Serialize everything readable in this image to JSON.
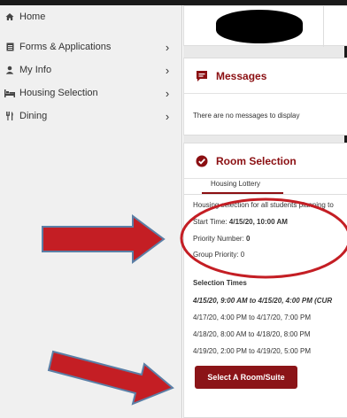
{
  "sidebar": {
    "items": [
      {
        "label": "Home",
        "icon": "home-icon",
        "chevron": false
      },
      {
        "label": "Forms & Applications",
        "icon": "document-icon",
        "chevron": true
      },
      {
        "label": "My Info",
        "icon": "user-icon",
        "chevron": true
      },
      {
        "label": "Housing Selection",
        "icon": "bed-icon",
        "chevron": true
      },
      {
        "label": "Dining",
        "icon": "utensils-icon",
        "chevron": true
      }
    ]
  },
  "messages": {
    "title": "Messages",
    "empty_text": "There are no messages to display"
  },
  "room_selection": {
    "title": "Room Selection",
    "tab_label": "Housing Lottery",
    "description": "Housing selection for all students planning to",
    "start_time_label": "Start Time:",
    "start_time_value": "4/15/20, 10:00 AM",
    "priority_label": "Priority Number:",
    "priority_value": "0",
    "group_priority": "Group Priority: 0",
    "selection_times_header": "Selection Times",
    "times": [
      "4/15/20, 9:00 AM to 4/15/20, 4:00 PM (CUR",
      "4/17/20, 4:00 PM to 4/17/20, 7:00 PM",
      "4/18/20, 8:00 AM to 4/18/20, 8:00 PM",
      "4/19/20, 2:00 PM to 4/19/20, 5:00 PM"
    ],
    "select_button": "Select A Room/Suite"
  },
  "colors": {
    "brand": "#8b0f12",
    "annotation_red": "#c41e24",
    "annotation_blue": "#5b7fa6"
  }
}
